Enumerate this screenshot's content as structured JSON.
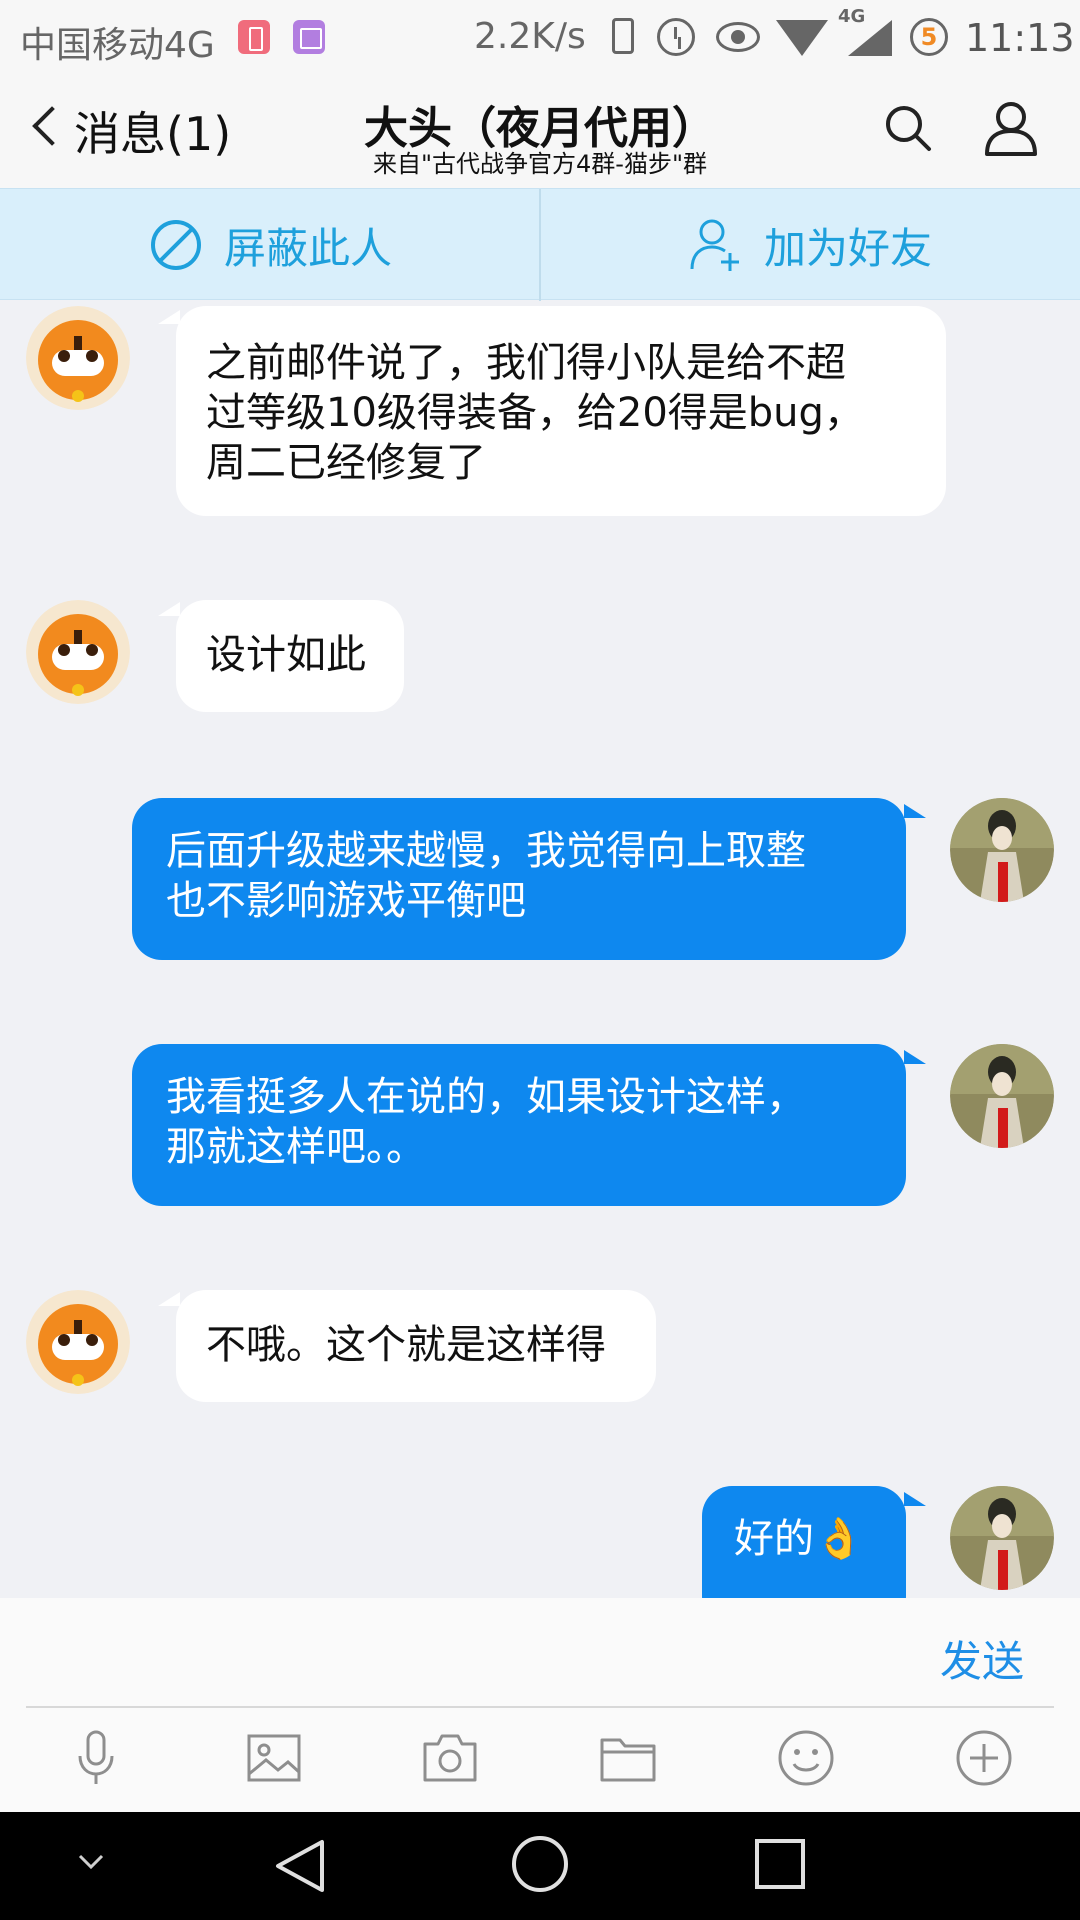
{
  "status_bar": {
    "carrier": "中国移动4G",
    "speed": "2.2K/s",
    "network_label": "4G",
    "badge": "5",
    "time": "11:13"
  },
  "header": {
    "back_label": "消息(1)",
    "title": "大头（夜月代用）",
    "subtitle": "来自\"古代战争官方4群-猫步\"群"
  },
  "actions": {
    "block_label": "屏蔽此人",
    "add_friend_label": "加为好友",
    "accent_color": "#1ea0dc"
  },
  "messages": [
    {
      "side": "in",
      "text_lines": [
        "之前邮件说了，我们得小队是给不超",
        "过等级10级得装备，给20得是bug，",
        "周二已经修复了"
      ]
    },
    {
      "side": "in",
      "text_lines": [
        "设计如此"
      ]
    },
    {
      "side": "out",
      "text_lines": [
        "后面升级越来越慢，我觉得向上取整",
        "也不影响游戏平衡吧"
      ]
    },
    {
      "side": "out",
      "text_lines": [
        "我看挺多人在说的，如果设计这样，",
        "那就这样吧。。"
      ]
    },
    {
      "side": "in",
      "text_lines": [
        "不哦。这个就是这样得"
      ]
    },
    {
      "side": "out",
      "text_lines": [
        "好的👌"
      ]
    }
  ],
  "input": {
    "value": "",
    "send_label": "发送",
    "send_color": "#1e8ee6"
  },
  "toolbar_icons": [
    "microphone-icon",
    "image-icon",
    "camera-icon",
    "folder-icon",
    "emoji-icon",
    "plus-icon"
  ],
  "nav_icons": [
    "chevron-down-icon",
    "back-triangle-icon",
    "home-circle-icon",
    "recents-square-icon"
  ],
  "colors": {
    "outgoing_bubble": "#0e88ef",
    "incoming_bubble": "#ffffff",
    "chat_background": "#f0f1f5"
  }
}
